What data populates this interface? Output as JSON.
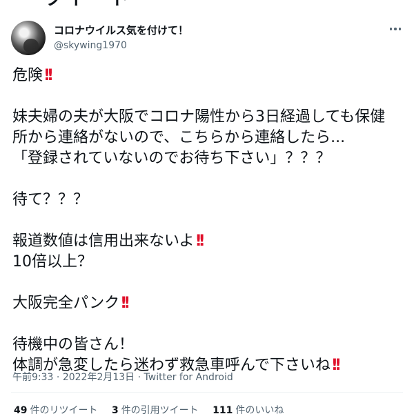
{
  "header_partial": "ツイート",
  "user": {
    "display_name": "コロナウイルス気を付けて！",
    "handle": "@skywing1970"
  },
  "tweet": {
    "line_1": "危険",
    "line_2": "妹夫婦の夫が大阪でコロナ陽性から3日経過しても保健",
    "line_3": "所から連絡がないので、こちらから連絡したら...",
    "line_4": "「登録されていないのでお待ち下さい」？？？",
    "line_5": "待て？？？",
    "line_6": "報道数値は信用出来ないよ",
    "line_7": "10倍以上？",
    "line_8": "大阪完全パンク",
    "line_9": "待機中の皆さん！",
    "line_10": "体調が急変したら迷わず救急車呼んで下さいね",
    "emphasis_mark": "!!"
  },
  "meta": {
    "time": "午前9:33",
    "separator_1": " · ",
    "date": "2022年2月13日",
    "separator_2": " · ",
    "source": "Twitter for Android"
  },
  "stats": {
    "retweets_count": "49",
    "retweets_label": "件のリツイート",
    "quotes_count": "3",
    "quotes_label": "件の引用ツイート",
    "likes_count": "111",
    "likes_label": "件のいいね"
  },
  "colors": {
    "text": "#0f1419",
    "secondary": "#536471",
    "emphasis": "#e0112b"
  }
}
